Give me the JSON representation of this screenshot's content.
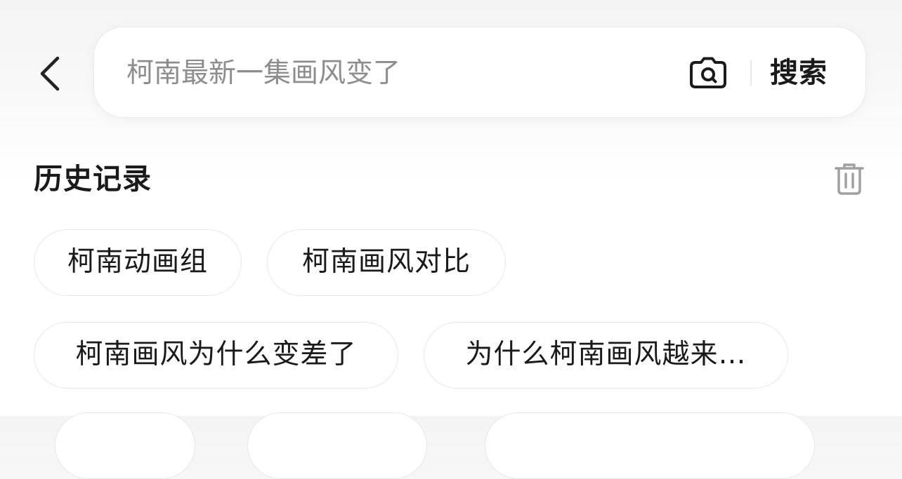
{
  "header": {
    "back_icon": "chevron-left-icon"
  },
  "search": {
    "placeholder": "柯南最新一集画风变了",
    "camera_icon": "camera-icon",
    "button_label": "搜索"
  },
  "history": {
    "title": "历史记录",
    "clear_icon": "trash-icon",
    "items": [
      "柯南动画组",
      "柯南画风对比",
      "柯南画风为什么变差了",
      "为什么柯南画风越来…"
    ]
  },
  "colors": {
    "text_primary": "#1a1a1a",
    "placeholder": "#8d8d8d",
    "border": "#e7e7e7",
    "icon_gray": "#a0a0a0"
  }
}
